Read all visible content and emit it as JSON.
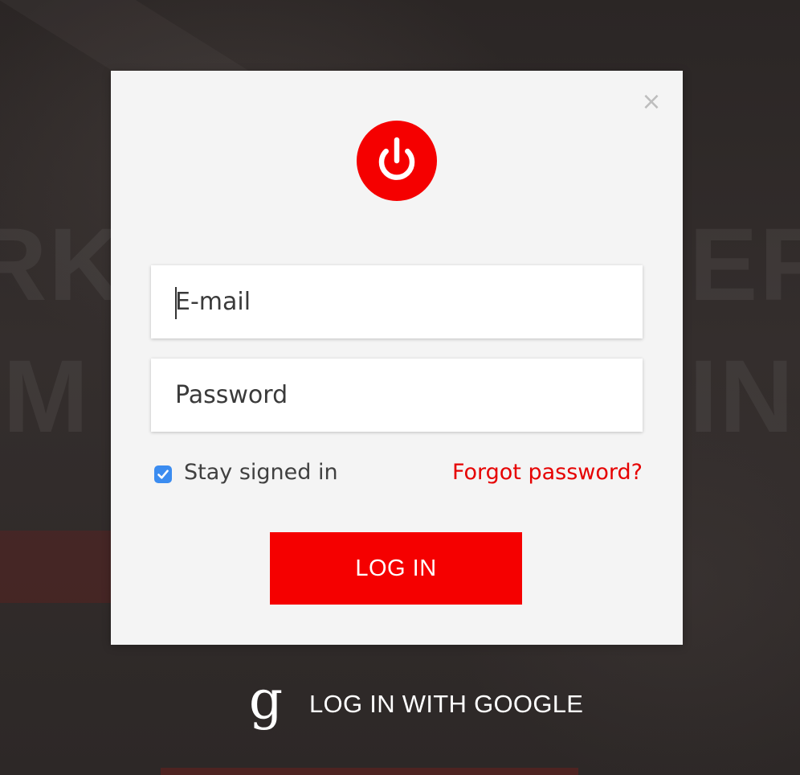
{
  "background": {
    "overlay_color": "#2f2a29",
    "faint_text": {
      "left_top": "RK",
      "left_bottom": "IM",
      "right_top": "EF",
      "right_bottom": "IN"
    }
  },
  "modal": {
    "background_color": "#f4f4f4",
    "close_icon": "close-icon",
    "close_glyph": "×",
    "logo": {
      "icon": "power-icon",
      "color": "#f50000"
    },
    "email": {
      "placeholder": "E-mail",
      "value": ""
    },
    "password": {
      "placeholder": "Password",
      "value": ""
    },
    "stay_signed_in": {
      "label": "Stay signed in",
      "checked": true,
      "color": "#3b8cf0"
    },
    "forgot_password": {
      "label": "Forgot password?",
      "color": "#e60000"
    },
    "login_button": {
      "label": "LOG IN",
      "color": "#f50000"
    }
  },
  "google_login": {
    "icon": "google-g-icon",
    "glyph": "g",
    "label": "LOG IN WITH GOOGLE"
  }
}
